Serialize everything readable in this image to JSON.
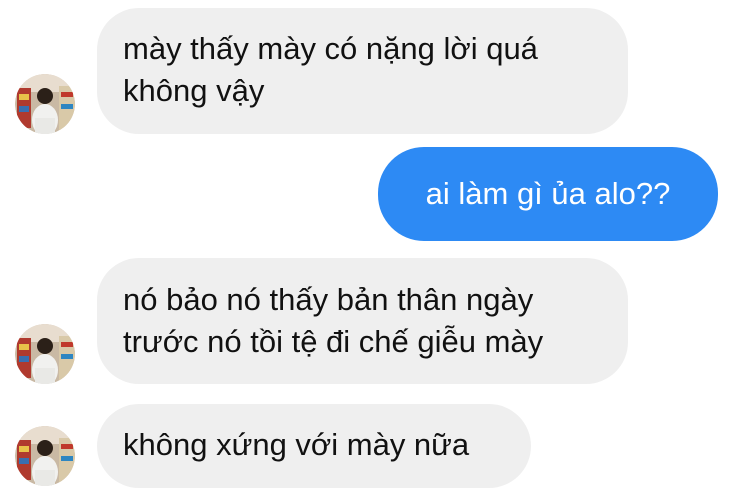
{
  "colors": {
    "incoming_bubble": "#efefef",
    "outgoing_bubble": "#2d8af4",
    "incoming_text": "#111111",
    "outgoing_text": "#ffffff",
    "background": "#ffffff"
  },
  "contact": {
    "avatar_icon": "contact-avatar-photo"
  },
  "messages": [
    {
      "direction": "incoming",
      "lines": [
        "mày thấy mày có nặng lời quá",
        "không vậy"
      ]
    },
    {
      "direction": "outgoing",
      "lines": [
        "ai làm gì ủa alo??"
      ]
    },
    {
      "direction": "incoming",
      "lines": [
        "nó bảo nó thấy bản thân ngày",
        "trước nó tồi tệ đi chế giễu mày"
      ]
    },
    {
      "direction": "incoming",
      "lines": [
        "không xứng với mày nữa"
      ]
    }
  ]
}
